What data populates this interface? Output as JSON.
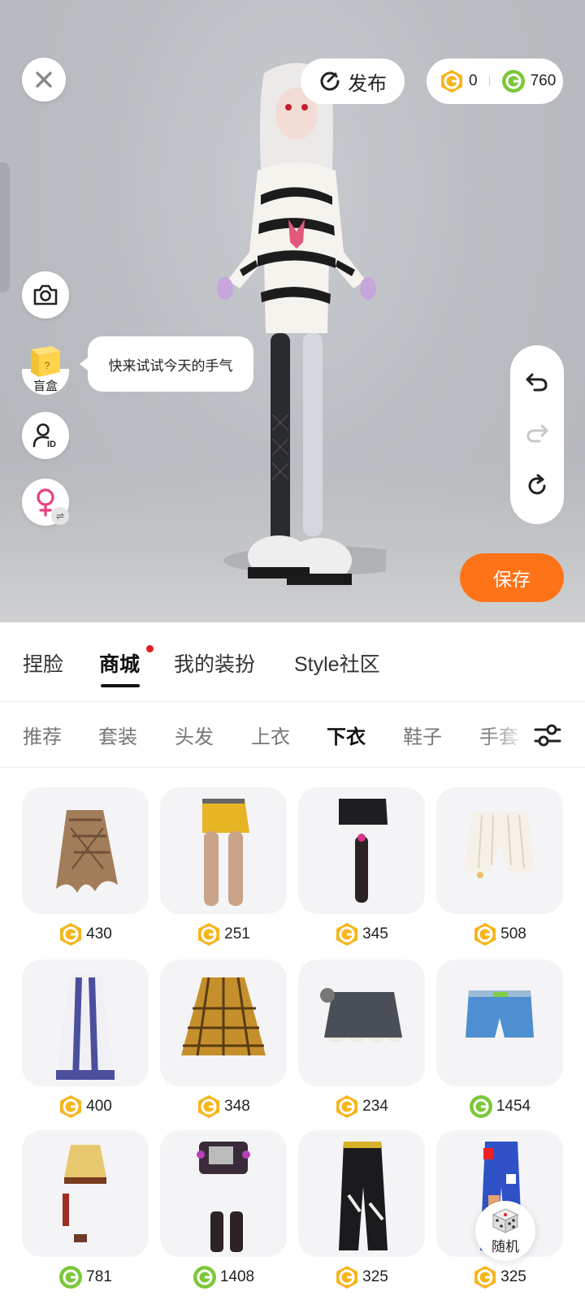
{
  "header": {
    "publish_label": "发布",
    "gold_coins": "0",
    "green_coins": "760"
  },
  "side": {
    "blind_box_label": "盲盒",
    "tooltip": "快来试试今天的手气"
  },
  "save_label": "保存",
  "main_tabs": [
    "捏脸",
    "商城",
    "我的装扮",
    "Style社区"
  ],
  "main_tab_active": "商城",
  "sub_tabs": [
    "推荐",
    "套装",
    "头发",
    "上衣",
    "下衣",
    "鞋子",
    "手套"
  ],
  "sub_tab_active": "下衣",
  "items": [
    {
      "price": "430",
      "currency": "gold",
      "kind": "fringe-skirt"
    },
    {
      "price": "251",
      "currency": "gold",
      "kind": "yellow-shorts-stockings"
    },
    {
      "price": "345",
      "currency": "gold",
      "kind": "black-shorts-sock"
    },
    {
      "price": "508",
      "currency": "gold",
      "kind": "white-bloomers"
    },
    {
      "price": "400",
      "currency": "gold",
      "kind": "patterned-long-skirt"
    },
    {
      "price": "348",
      "currency": "gold",
      "kind": "plaid-skirt"
    },
    {
      "price": "234",
      "currency": "gold",
      "kind": "dark-frilled-skirt"
    },
    {
      "price": "1454",
      "currency": "green",
      "kind": "denim-shorts"
    },
    {
      "price": "781",
      "currency": "green",
      "kind": "lampshade-skirt"
    },
    {
      "price": "1408",
      "currency": "green",
      "kind": "studded-shorts-boots"
    },
    {
      "price": "325",
      "currency": "gold",
      "kind": "black-cargo-pants"
    },
    {
      "price": "325",
      "currency": "gold",
      "kind": "blue-patch-pants"
    }
  ],
  "random_label": "随机",
  "colors": {
    "accent_orange": "#ff7318",
    "gold_coin": "#f6b51c",
    "green_coin": "#7cc83a",
    "notify_red": "#e31d1d"
  }
}
